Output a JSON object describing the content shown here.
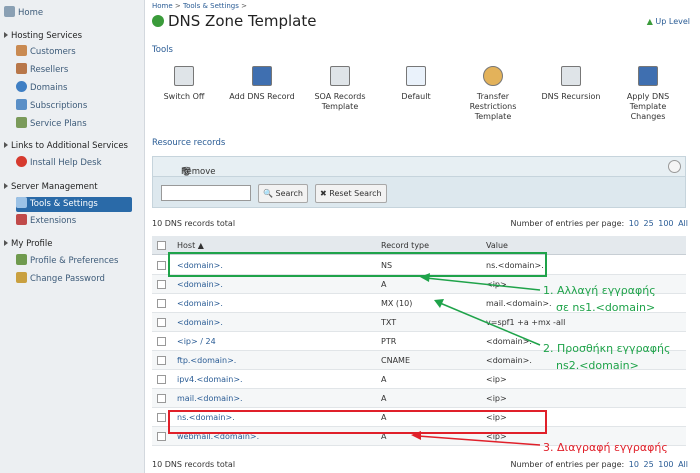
{
  "sidebar": {
    "home": "Home",
    "sections": [
      {
        "title": "Hosting Services",
        "items": [
          "Customers",
          "Resellers",
          "Domains",
          "Subscriptions",
          "Service Plans"
        ]
      },
      {
        "title": "Links to Additional Services",
        "items": [
          "Install Help Desk"
        ]
      },
      {
        "title": "Server Management",
        "items": [
          "Tools & Settings",
          "Extensions"
        ]
      },
      {
        "title": "My Profile",
        "items": [
          "Profile & Preferences",
          "Change Password"
        ]
      }
    ]
  },
  "breadcrumb": {
    "home": "Home",
    "sep": ">",
    "tools": "Tools & Settings",
    "sep2": ">"
  },
  "page": {
    "title": "DNS Zone Template",
    "up_level": "Up Level"
  },
  "tools": {
    "heading": "Tools",
    "items": [
      {
        "l1": "Switch Off",
        "l2": "",
        "l3": ""
      },
      {
        "l1": "Add DNS Record",
        "l2": "",
        "l3": ""
      },
      {
        "l1": "SOA Records",
        "l2": "Template",
        "l3": ""
      },
      {
        "l1": "Default",
        "l2": "",
        "l3": ""
      },
      {
        "l1": "Transfer",
        "l2": "Restrictions",
        "l3": "Template"
      },
      {
        "l1": "DNS Recursion",
        "l2": "",
        "l3": ""
      },
      {
        "l1": "Apply DNS",
        "l2": "Template",
        "l3": "Changes"
      }
    ]
  },
  "records": {
    "heading": "Resource records",
    "remove": "Remove",
    "search_button": "Search",
    "reset_button": "Reset Search",
    "total": "10 DNS records total",
    "entries_label": "Number of entries per page:",
    "entries": [
      "10",
      "25",
      "100",
      "All"
    ],
    "columns": {
      "host": "Host",
      "type": "Record type",
      "value": "Value"
    },
    "rows": [
      {
        "host": "<domain>.",
        "type": "NS",
        "value": "ns.<domain>."
      },
      {
        "host": "<domain>.",
        "type": "A",
        "value": "<ip>"
      },
      {
        "host": "<domain>.",
        "type": "MX (10)",
        "value": "mail.<domain>."
      },
      {
        "host": "<domain>.",
        "type": "TXT",
        "value": "v=spf1 +a +mx -all"
      },
      {
        "host": "<ip> / 24",
        "type": "PTR",
        "value": "<domain>."
      },
      {
        "host": "ftp.<domain>.",
        "type": "CNAME",
        "value": "<domain>."
      },
      {
        "host": "ipv4.<domain>.",
        "type": "A",
        "value": "<ip>"
      },
      {
        "host": "mail.<domain>.",
        "type": "A",
        "value": "<ip>"
      },
      {
        "host": "ns.<domain>.",
        "type": "A",
        "value": "<ip>"
      },
      {
        "host": "webmail.<domain>.",
        "type": "A",
        "value": "<ip>"
      }
    ]
  },
  "annotations": {
    "a1_line1": "1. Αλλαγή εγγραφής",
    "a1_line2": "σε ns1.<domain>",
    "a2_line1": "2. Προσθήκη εγγραφής",
    "a2_line2": "ns2.<domain>",
    "a3": "3. Διαγραφή εγγραφής"
  },
  "colors": {
    "green": "#1fa34a",
    "red": "#e0202a",
    "link": "#2a5c95",
    "selected": "#2a6aa8"
  }
}
